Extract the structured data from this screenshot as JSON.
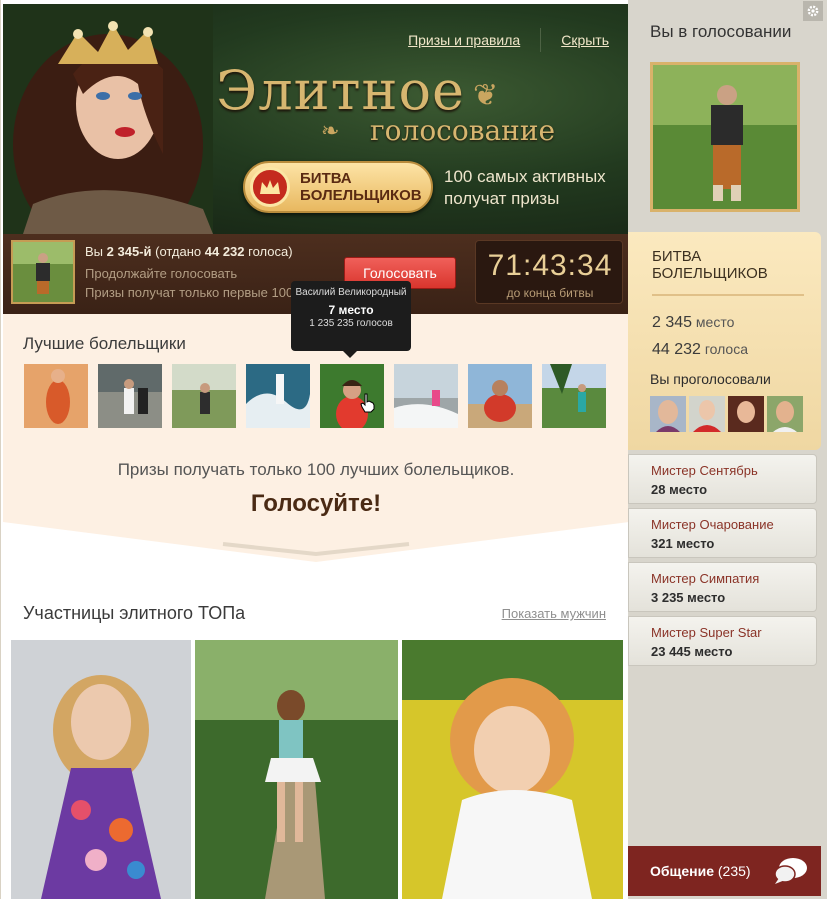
{
  "header": {
    "link_prizes": "Призы и правила",
    "link_hide": "Скрыть",
    "title_line1": "Элитное",
    "title_line2": "голосование",
    "badge_line1": "БИТВА",
    "badge_line2": "БОЛЕЛЬЩИКОВ",
    "badge_desc": "100 самых активных получат призы"
  },
  "vote_bar": {
    "you_prefix": "Вы ",
    "your_rank": "2 345-й",
    "given_prefix": " (отдано ",
    "votes_given": "44 232",
    "given_suffix": " голоса)",
    "keep_voting": "Продолжайте голосовать",
    "prize_note": "Призы получат только первые 100",
    "vote_button": "Голосовать",
    "timer": "71:43:34",
    "timer_label": "до конца битвы"
  },
  "best": {
    "title": "Лучшие болельщики",
    "prize_text": "Призы получать только 100 лучших болельщиков.",
    "call": "Голосуйте!"
  },
  "tooltip": {
    "name": "Василий Великородный",
    "place": "7 место",
    "votes": "1 235 235 голосов"
  },
  "elite": {
    "title": "Участницы элитного ТОПа",
    "show_men": "Показать мужчин"
  },
  "sidebar": {
    "you_title": "Вы в голосовании",
    "battle_title_1": "БИТВА",
    "battle_title_2": "БОЛЕЛЬЩИКОВ",
    "place_value": "2 345",
    "place_label": " место",
    "votes_value": "44 232",
    "votes_label": " голоса",
    "voted_label": "Вы проголосовали",
    "contests": [
      {
        "name": "Мистер Сентябрь",
        "place": "28 место"
      },
      {
        "name": "Мистер Очарование",
        "place": "321 место"
      },
      {
        "name": "Мистер Симпатия",
        "place": "3 235 место"
      },
      {
        "name": "Мистер Super Star",
        "place": "23 445 место"
      }
    ],
    "chat_label": "Общение",
    "chat_count": " (235)"
  },
  "colors": {
    "accent_red": "#d9352d",
    "brown": "#4a2a14",
    "gold": "#d7b670",
    "chat_bg": "#7e2520"
  },
  "icons": [
    "gear-icon",
    "crown-icon",
    "chat-bubble-icon",
    "hand-cursor-icon"
  ]
}
